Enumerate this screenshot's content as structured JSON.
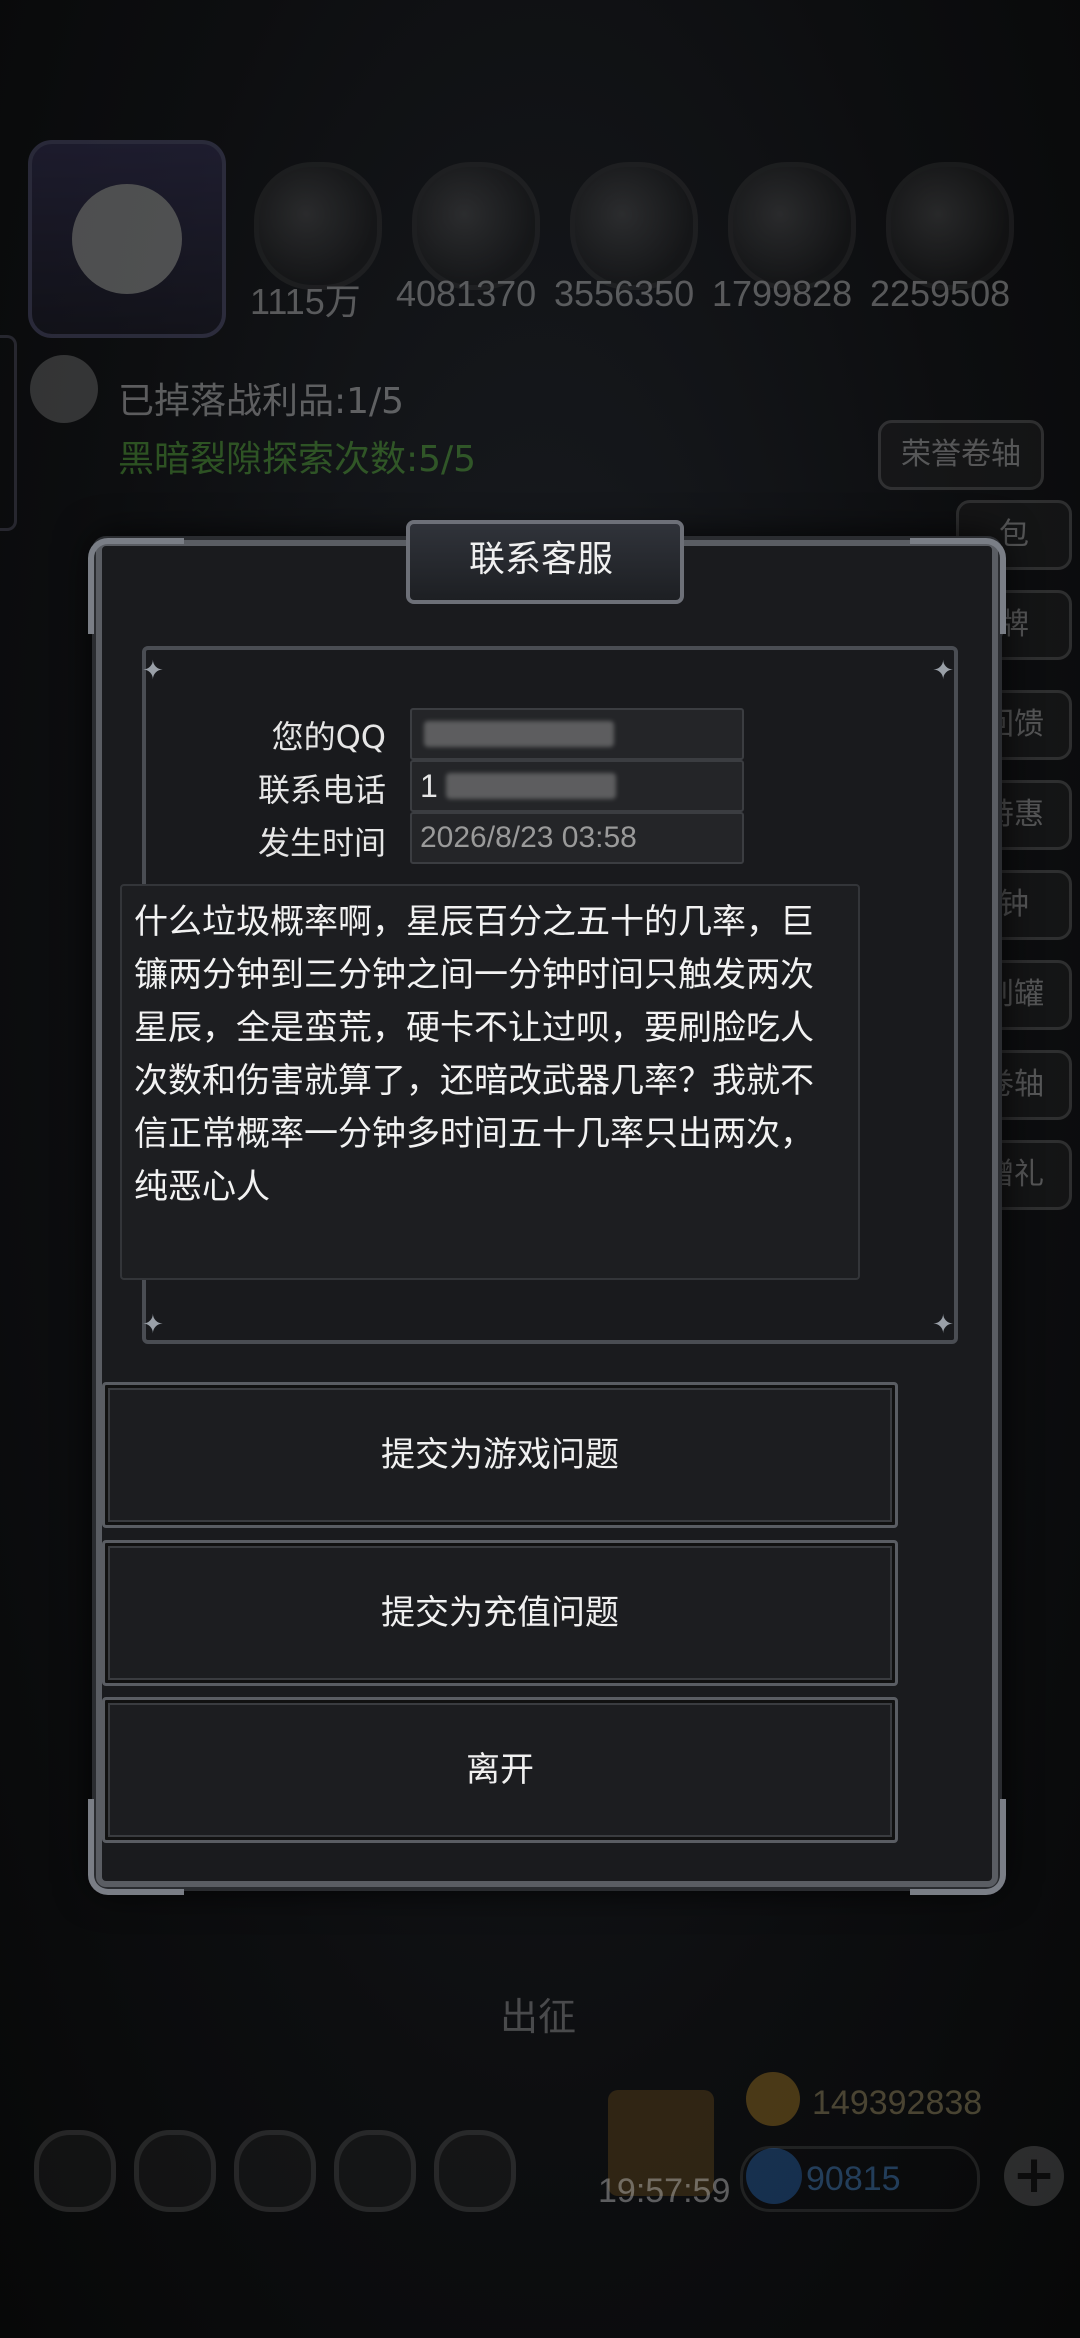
{
  "background": {
    "resources": [
      "1115万",
      "4081370",
      "3556350",
      "1799828",
      "2259508"
    ],
    "loot_text": "已掉落战利品:1/5",
    "rift_text": "黑暗裂隙探索次数:5/5",
    "honor_scroll": "荣誉卷轴",
    "side_buttons": [
      "包",
      "牌",
      "回馈",
      "特惠",
      "钟",
      "刮罐",
      "卷轴",
      "赠礼"
    ],
    "expedition": "出征",
    "clock": "19:57:59",
    "gold": "149392838",
    "gems": "90815",
    "plus_symbol": "+"
  },
  "dialog": {
    "title": "联系客服",
    "labels": {
      "qq": "您的QQ",
      "phone": "联系电话",
      "time": "发生时间"
    },
    "phone_visible_prefix": "1",
    "time_value": "2026/8/23 03:58",
    "message": "什么垃圾概率啊，星辰百分之五十的几率，巨镰两分钟到三分钟之间一分钟时间只触发两次星辰，全是蛮荒，硬卡不让过呗，要刷脸吃人次数和伤害就算了，还暗改武器几率？我就不信正常概率一分钟多时间五十几率只出两次，纯恶心人",
    "buttons": {
      "game_issue": "提交为游戏问题",
      "recharge_issue": "提交为充值问题",
      "leave": "离开"
    },
    "sparkle": "✦"
  }
}
